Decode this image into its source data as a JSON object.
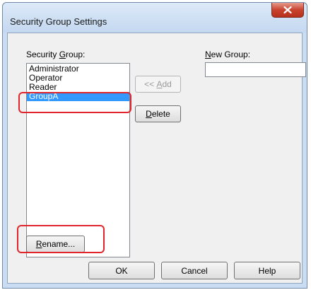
{
  "window": {
    "title": "Security Group Settings",
    "close_glyph": "x"
  },
  "security_group": {
    "label_prefix": "Security ",
    "label_mnemonic": "G",
    "label_suffix": "roup:",
    "items": [
      {
        "label": "Administrator",
        "selected": false
      },
      {
        "label": "Operator",
        "selected": false
      },
      {
        "label": "Reader",
        "selected": false
      },
      {
        "label": "GroupA",
        "selected": true
      }
    ]
  },
  "new_group": {
    "label_mnemonic": "N",
    "label_suffix": "ew Group:",
    "value": ""
  },
  "buttons": {
    "add_prefix": "<< ",
    "add_mnemonic": "A",
    "add_suffix": "dd",
    "delete_mnemonic": "D",
    "delete_suffix": "elete",
    "rename_mnemonic": "R",
    "rename_suffix": "ename...",
    "ok": "OK",
    "cancel": "Cancel",
    "help": "Help"
  },
  "colors": {
    "selection": "#3399ff",
    "highlight_annotation": "#e0262c",
    "close_button": "#c8432e"
  }
}
